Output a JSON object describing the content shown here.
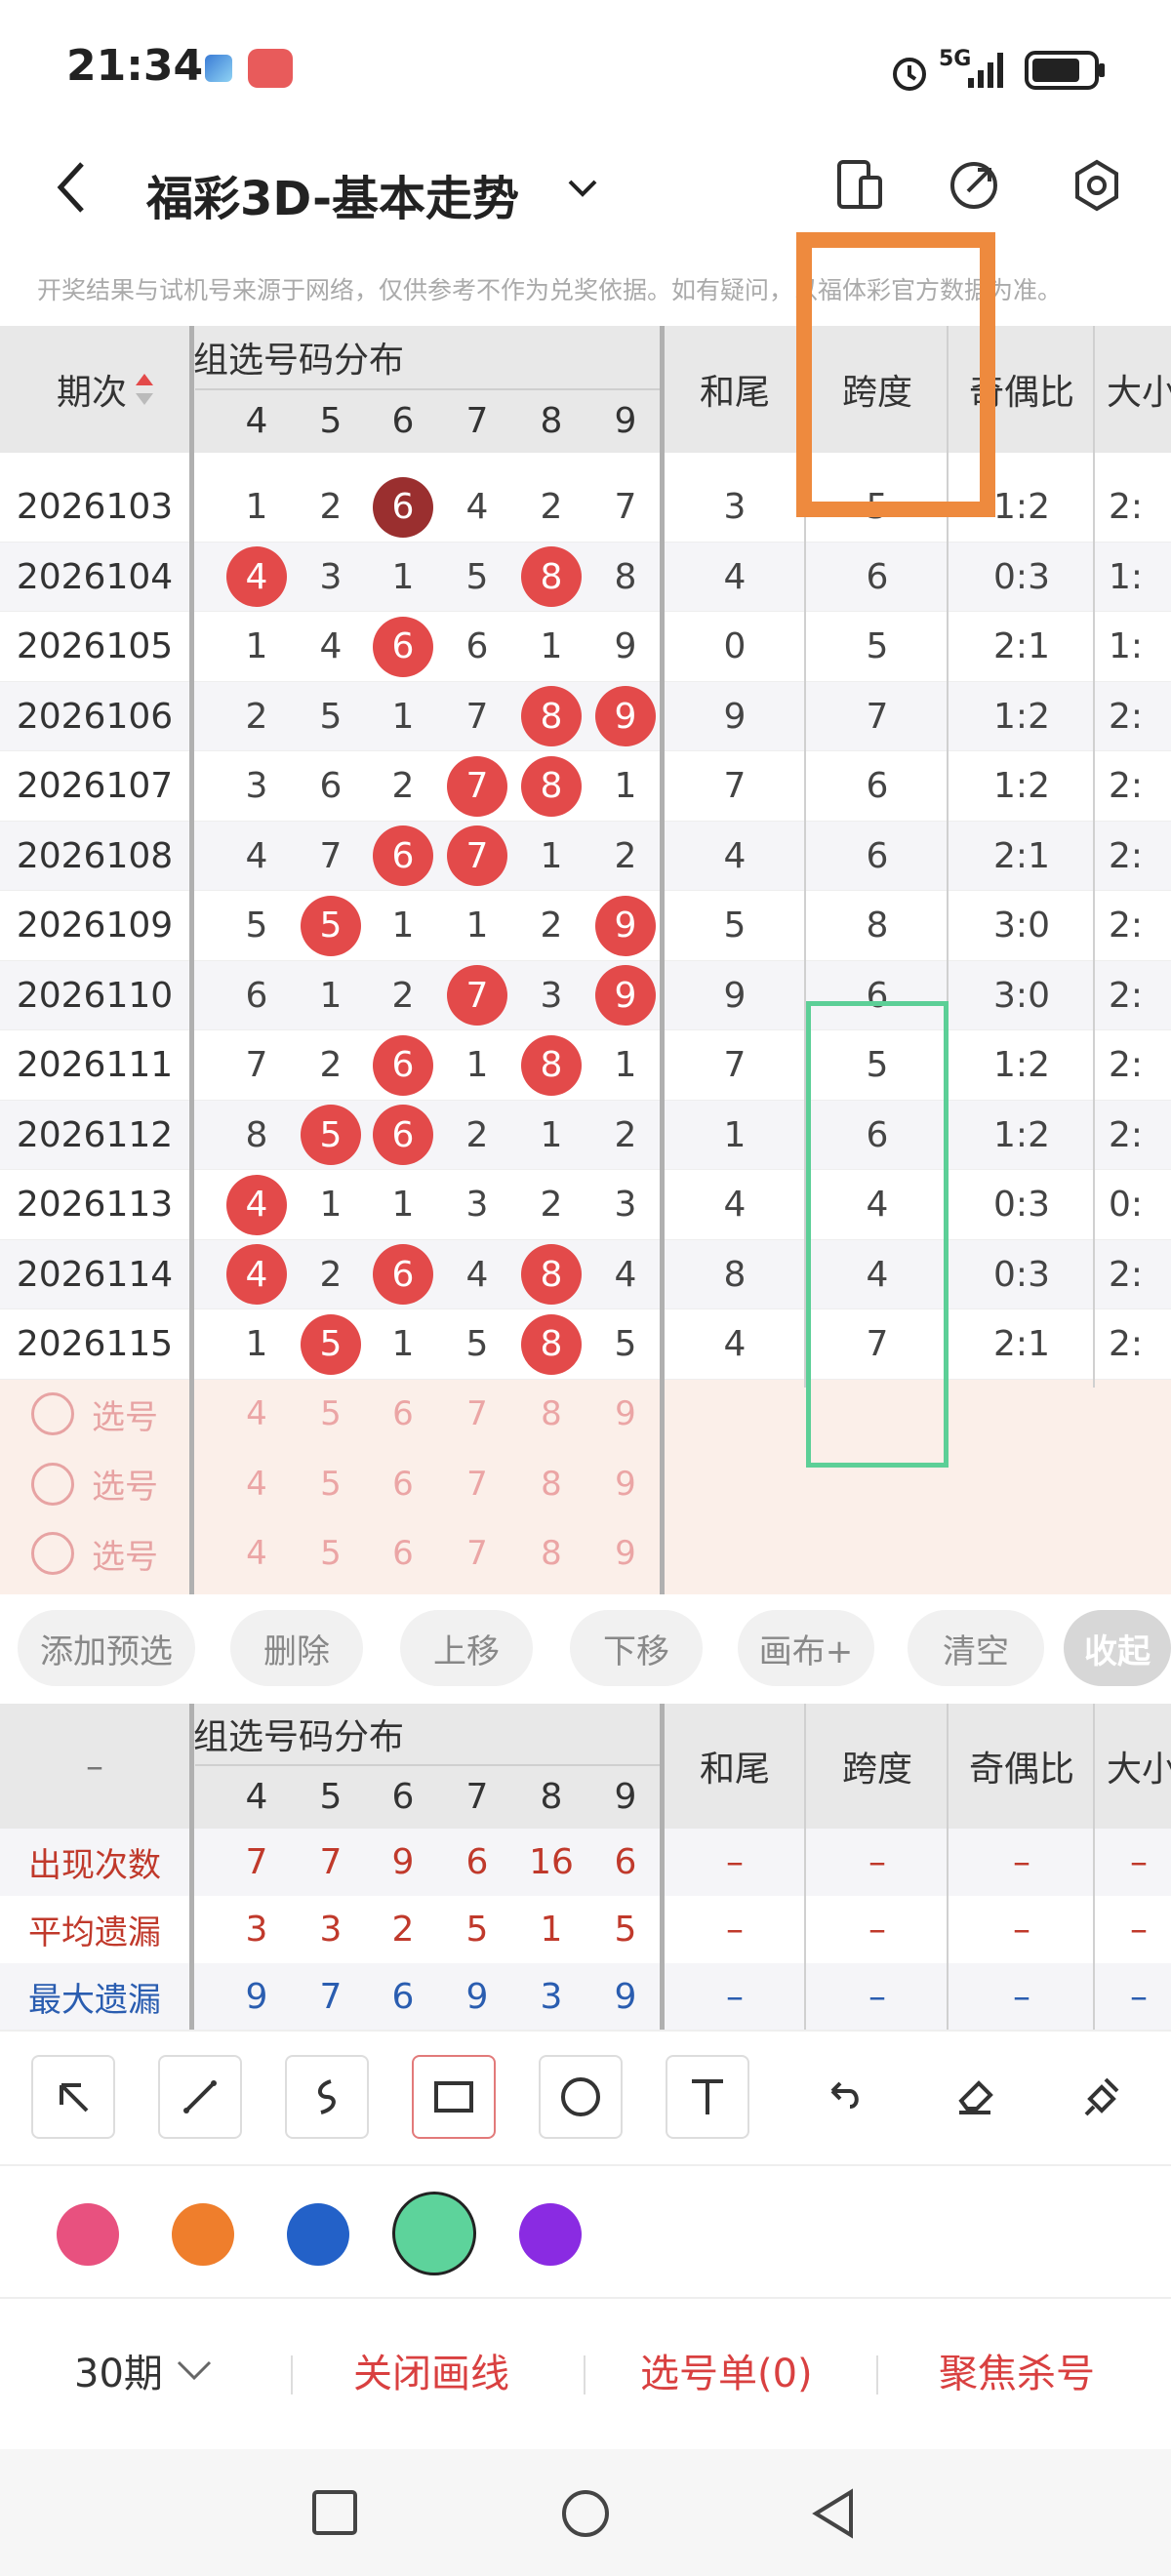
{
  "status_bar": {
    "time": "21:34",
    "network": "5G"
  },
  "header": {
    "title": "福彩3D-基本走势"
  },
  "notice": "开奖结果与试机号来源于网络，仅供参考不作为兑奖依据。如有疑问，以福体彩官方数据为准。",
  "table": {
    "header": {
      "period": "期次",
      "group_dist": "组选号码分布",
      "digits": [
        "4",
        "5",
        "6",
        "7",
        "8",
        "9"
      ],
      "hewei": "和尾",
      "kuadu": "跨度",
      "jiou": "奇偶比",
      "daxiao": "大小"
    },
    "rows": [
      {
        "period": "2026103",
        "cells": [
          "1",
          "2",
          "6",
          "4",
          "2",
          "7"
        ],
        "balls": [
          2
        ],
        "dark": [
          2
        ],
        "hewei": "3",
        "kuadu": "5",
        "jiou": "1:2",
        "daxiao": "2:"
      },
      {
        "period": "2026104",
        "cells": [
          "4",
          "3",
          "1",
          "5",
          "8",
          "8"
        ],
        "balls": [
          0,
          4
        ],
        "dark": [],
        "hewei": "4",
        "kuadu": "6",
        "jiou": "0:3",
        "daxiao": "1:"
      },
      {
        "period": "2026105",
        "cells": [
          "1",
          "4",
          "6",
          "6",
          "1",
          "9"
        ],
        "balls": [
          2
        ],
        "dark": [],
        "hewei": "0",
        "kuadu": "5",
        "jiou": "2:1",
        "daxiao": "1:"
      },
      {
        "period": "2026106",
        "cells": [
          "2",
          "5",
          "1",
          "7",
          "8",
          "9"
        ],
        "balls": [
          4,
          5
        ],
        "dark": [],
        "hewei": "9",
        "kuadu": "7",
        "jiou": "1:2",
        "daxiao": "2:"
      },
      {
        "period": "2026107",
        "cells": [
          "3",
          "6",
          "2",
          "7",
          "8",
          "1"
        ],
        "balls": [
          3,
          4
        ],
        "dark": [],
        "hewei": "7",
        "kuadu": "6",
        "jiou": "1:2",
        "daxiao": "2:"
      },
      {
        "period": "2026108",
        "cells": [
          "4",
          "7",
          "6",
          "7",
          "1",
          "2"
        ],
        "balls": [
          2,
          3
        ],
        "dark": [],
        "hewei": "4",
        "kuadu": "6",
        "jiou": "2:1",
        "daxiao": "2:"
      },
      {
        "period": "2026109",
        "cells": [
          "5",
          "5",
          "1",
          "1",
          "2",
          "9"
        ],
        "balls": [
          1,
          5
        ],
        "dark": [],
        "hewei": "5",
        "kuadu": "8",
        "jiou": "3:0",
        "daxiao": "2:"
      },
      {
        "period": "2026110",
        "cells": [
          "6",
          "1",
          "2",
          "7",
          "3",
          "9"
        ],
        "balls": [
          3,
          5
        ],
        "dark": [],
        "hewei": "9",
        "kuadu": "6",
        "jiou": "3:0",
        "daxiao": "2:"
      },
      {
        "period": "2026111",
        "cells": [
          "7",
          "2",
          "6",
          "1",
          "8",
          "1"
        ],
        "balls": [
          2,
          4
        ],
        "dark": [],
        "hewei": "7",
        "kuadu": "5",
        "jiou": "1:2",
        "daxiao": "2:"
      },
      {
        "period": "2026112",
        "cells": [
          "8",
          "5",
          "6",
          "2",
          "1",
          "2"
        ],
        "balls": [
          1,
          2
        ],
        "dark": [],
        "hewei": "1",
        "kuadu": "6",
        "jiou": "1:2",
        "daxiao": "2:"
      },
      {
        "period": "2026113",
        "cells": [
          "4",
          "1",
          "1",
          "3",
          "2",
          "3"
        ],
        "balls": [
          0
        ],
        "dark": [],
        "hewei": "4",
        "kuadu": "4",
        "jiou": "0:3",
        "daxiao": "0:"
      },
      {
        "period": "2026114",
        "cells": [
          "4",
          "2",
          "6",
          "4",
          "8",
          "4"
        ],
        "balls": [
          0,
          2,
          4
        ],
        "dark": [],
        "hewei": "8",
        "kuadu": "4",
        "jiou": "0:3",
        "daxiao": "2:"
      },
      {
        "period": "2026115",
        "cells": [
          "1",
          "5",
          "1",
          "5",
          "8",
          "5"
        ],
        "balls": [
          1,
          4
        ],
        "dark": [],
        "hewei": "4",
        "kuadu": "7",
        "jiou": "2:1",
        "daxiao": "2:"
      }
    ],
    "select_label": "选号",
    "select_digits": [
      "4",
      "5",
      "6",
      "7",
      "8",
      "9"
    ]
  },
  "actions": [
    "添加预选",
    "删除",
    "上移",
    "下移",
    "画布+",
    "清空",
    "收起"
  ],
  "stats": {
    "header_period": "–",
    "rows": [
      {
        "label": "出现次数",
        "color": "#c0392b",
        "cells": [
          "7",
          "7",
          "9",
          "6",
          "16",
          "6"
        ]
      },
      {
        "label": "平均遗漏",
        "color": "#c0392b",
        "cells": [
          "3",
          "3",
          "2",
          "5",
          "1",
          "5"
        ]
      },
      {
        "label": "最大遗漏",
        "color": "#2a5db0",
        "cells": [
          "9",
          "7",
          "6",
          "9",
          "3",
          "9"
        ]
      }
    ],
    "dash": "–"
  },
  "draw_tools": [
    "arrow-tool",
    "line-tool",
    "curve-tool",
    "rect-tool",
    "circle-tool",
    "text-tool",
    "undo-tool",
    "eraser-tool",
    "clear-tool"
  ],
  "colors": [
    "#e8517f",
    "#ef7e2c",
    "#2361c8",
    "#5dd39b",
    "#8a2be2"
  ],
  "bottom_bar": {
    "period_select": "30期",
    "close_draw": "关闭画线",
    "pick_list": "选号单(0)",
    "focus_kill": "聚焦杀号"
  }
}
